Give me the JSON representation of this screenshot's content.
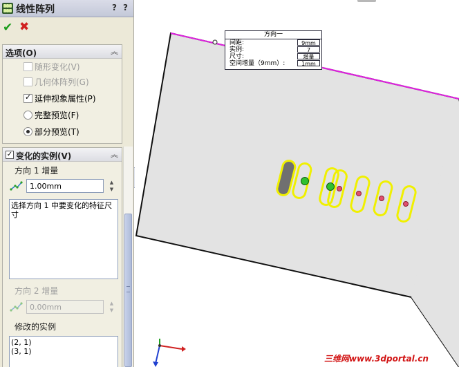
{
  "property_manager": {
    "title": "线性阵列",
    "help_icon_label": "?",
    "help_label": "?",
    "ok_icon": "✔",
    "cancel_icon": "✖"
  },
  "options_group": {
    "title": "选项(O)",
    "collapse_icon": "chevron-up-double",
    "items": [
      {
        "label": "随形变化(V)",
        "checked": false,
        "enabled": false
      },
      {
        "label": "几何体阵列(G)",
        "checked": false,
        "enabled": false
      },
      {
        "label": "延伸视象属性(P)",
        "checked": true,
        "enabled": true
      },
      {
        "label": "完整预览(F)",
        "selected": false
      },
      {
        "label": "部分预览(T)",
        "selected": true
      }
    ]
  },
  "varied_instances": {
    "title": "变化的实例(V)",
    "checked": true,
    "direction1_label": "方向 1 增量",
    "direction1_value": "1.00mm",
    "selection_hint": "选择方向 1 中要变化的特征尺寸",
    "direction2_label": "方向 2 增量",
    "direction2_value": "0.00mm",
    "modified_label": "修改的实例",
    "modified_items": [
      "(2, 1)",
      "(3, 1)"
    ]
  },
  "callout": {
    "title": "方向一",
    "rows": [
      {
        "label": "间距:",
        "value": "9mm"
      },
      {
        "label": "实例:",
        "value": "7"
      },
      {
        "label": "尺寸:",
        "value": "增量"
      },
      {
        "label": "空间增量（9mm）:",
        "value": "1mm"
      }
    ]
  },
  "watermark": "三维网www.3dportal.cn",
  "colors": {
    "plate": "#e3e3e3",
    "highlight_edge": "#e020e0",
    "slot_outline": "#f0f000",
    "seed_slot_fill": "#707070",
    "point_green": "#30c030",
    "point_pink": "#e05070"
  }
}
